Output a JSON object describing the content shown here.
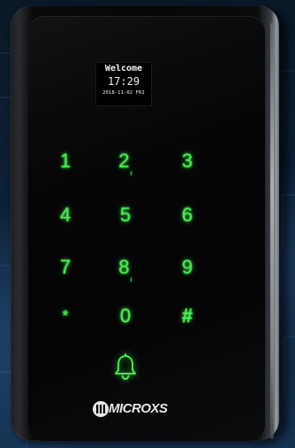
{
  "display": {
    "line1": "Welcome",
    "line2": "17:29",
    "line3": "2018-11-02  FRI"
  },
  "keypad": {
    "keys": [
      "1",
      "2",
      "3",
      "4",
      "5",
      "6",
      "7",
      "8",
      "9",
      "*",
      "0",
      "#"
    ],
    "bell_icon": "bell-icon"
  },
  "brand": {
    "logo_text": "MICROXS"
  },
  "colors": {
    "key_glow": "#3ff04f",
    "screen_text": "#f2f2f2",
    "device_body": "#050506"
  }
}
